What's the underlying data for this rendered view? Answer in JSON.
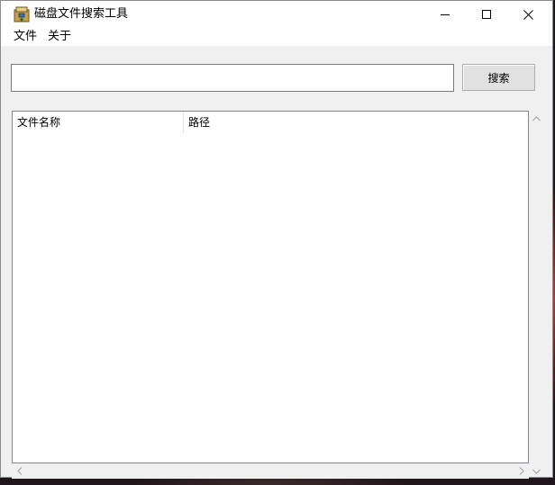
{
  "window": {
    "title": "磁盘文件搜索工具"
  },
  "menu": {
    "items": [
      {
        "label": "文件"
      },
      {
        "label": "关于"
      }
    ]
  },
  "search": {
    "value": "",
    "button_label": "搜索"
  },
  "list": {
    "columns": [
      "文件名称",
      "路径"
    ],
    "rows": []
  },
  "icons": {
    "app": "archive-icon",
    "minimize": "minimize-icon",
    "maximize": "maximize-icon",
    "close": "close-icon"
  },
  "colors": {
    "window_bg": "#f0f0f0",
    "titlebar_bg": "#ffffff",
    "button_bg": "#e1e1e1",
    "list_bg": "#ffffff"
  }
}
